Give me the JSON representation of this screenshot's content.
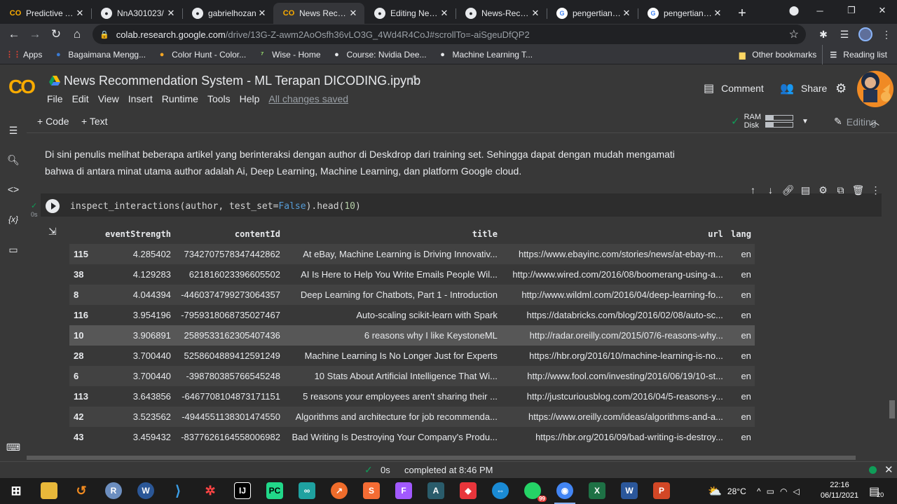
{
  "browser": {
    "tabs": [
      {
        "title": "Predictive An",
        "favicon": "colab",
        "active": false
      },
      {
        "title": "NnA301023/",
        "favicon": "github",
        "active": false
      },
      {
        "title": "gabrielhozan",
        "favicon": "github",
        "active": false
      },
      {
        "title": "News Recom",
        "favicon": "colab",
        "active": true
      },
      {
        "title": "Editing News",
        "favicon": "github",
        "active": false
      },
      {
        "title": "News-Recom",
        "favicon": "github",
        "active": false
      },
      {
        "title": "pengertian st",
        "favicon": "google",
        "active": false
      },
      {
        "title": "pengertian ta",
        "favicon": "google",
        "active": false
      }
    ],
    "url_domain": "colab.research.google.com",
    "url_path": "/drive/13G-Z-awm2AoOsfh36vLO3G_4Wd4R4CoJ#scrollTo=-aiSgeuDfQP2",
    "bookmarks": [
      {
        "label": "Apps",
        "icon": "apps-grid-icon"
      },
      {
        "label": "Bagaimana Mengg...",
        "icon": "bookmark-icon"
      },
      {
        "label": "Color Hunt - Color...",
        "icon": "bookmark-icon"
      },
      {
        "label": "Wise - Home",
        "icon": "wise-icon"
      },
      {
        "label": "Course: Nvidia Dee...",
        "icon": "bookmark-icon"
      },
      {
        "label": "Machine Learning T...",
        "icon": "bookmark-icon"
      }
    ],
    "other_bookmarks": "Other bookmarks",
    "reading_list": "Reading list"
  },
  "notebook": {
    "title": "News Recommendation System - ML Terapan DICODING.ipynb",
    "menu": [
      "File",
      "Edit",
      "View",
      "Insert",
      "Runtime",
      "Tools",
      "Help"
    ],
    "saved_status": "All changes saved",
    "comment_label": "Comment",
    "share_label": "Share",
    "add_code": "+ Code",
    "add_text": "+ Text",
    "ram_label": "RAM",
    "disk_label": "Disk",
    "ram_usage": 0.3,
    "disk_usage": 0.3,
    "mode_label": "Editing",
    "text_cell": "Di sini penulis melihat beberapa artikel yang berinteraksi dengan author di Deskdrop dari training set. Sehingga dapat dengan mudah mengamati bahwa di antara minat utama author adalah Ai, Deep Learning, Machine Learning, dan platform Google cloud.",
    "code_fn": "inspect_interactions(author, test_set=",
    "code_kw": "False",
    "code_mid": ").head(",
    "code_num": "10",
    "code_end": ")",
    "exec_time": "0s"
  },
  "dataframe": {
    "columns": [
      "",
      "eventStrength",
      "contentId",
      "title",
      "url",
      "lang"
    ],
    "rows": [
      [
        "115",
        "4.285402",
        "7342707578347442862",
        "At eBay, Machine Learning is Driving Innovativ...",
        "https://www.ebayinc.com/stories/news/at-ebay-m...",
        "en"
      ],
      [
        "38",
        "4.129283",
        "621816023396605502",
        "AI Is Here to Help You Write Emails People Wil...",
        "http://www.wired.com/2016/08/boomerang-using-a...",
        "en"
      ],
      [
        "8",
        "4.044394",
        "-4460374799273064357",
        "Deep Learning for Chatbots, Part 1 - Introduction",
        "http://www.wildml.com/2016/04/deep-learning-fo...",
        "en"
      ],
      [
        "116",
        "3.954196",
        "-7959318068735027467",
        "Auto-scaling scikit-learn with Spark",
        "https://databricks.com/blog/2016/02/08/auto-sc...",
        "en"
      ],
      [
        "10",
        "3.906891",
        "2589533162305407436",
        "6 reasons why I like KeystoneML",
        "http://radar.oreilly.com/2015/07/6-reasons-why...",
        "en"
      ],
      [
        "28",
        "3.700440",
        "5258604889412591249",
        "Machine Learning Is No Longer Just for Experts",
        "https://hbr.org/2016/10/machine-learning-is-no...",
        "en"
      ],
      [
        "6",
        "3.700440",
        "-398780385766545248",
        "10 Stats About Artificial Intelligence That Wi...",
        "http://www.fool.com/investing/2016/06/19/10-st...",
        "en"
      ],
      [
        "113",
        "3.643856",
        "-6467708104873171151",
        "5 reasons your employees aren't sharing their ...",
        "http://justcuriousblog.com/2016/04/5-reasons-y...",
        "en"
      ],
      [
        "42",
        "3.523562",
        "-4944551138301474550",
        "Algorithms and architecture for job recommenda...",
        "https://www.oreilly.com/ideas/algorithms-and-a...",
        "en"
      ],
      [
        "43",
        "3.459432",
        "-8377626164558006982",
        "Bad Writing Is Destroying Your Company's Produ...",
        "https://hbr.org/2016/09/bad-writing-is-destroy...",
        "en"
      ]
    ]
  },
  "statusbar": {
    "exec_time": "0s",
    "completed": "completed at 8:46 PM"
  },
  "taskbar": {
    "weather": "28°C",
    "time": "22:16",
    "date": "06/11/2021",
    "whatsapp_badge": "99",
    "notifications": "20"
  }
}
